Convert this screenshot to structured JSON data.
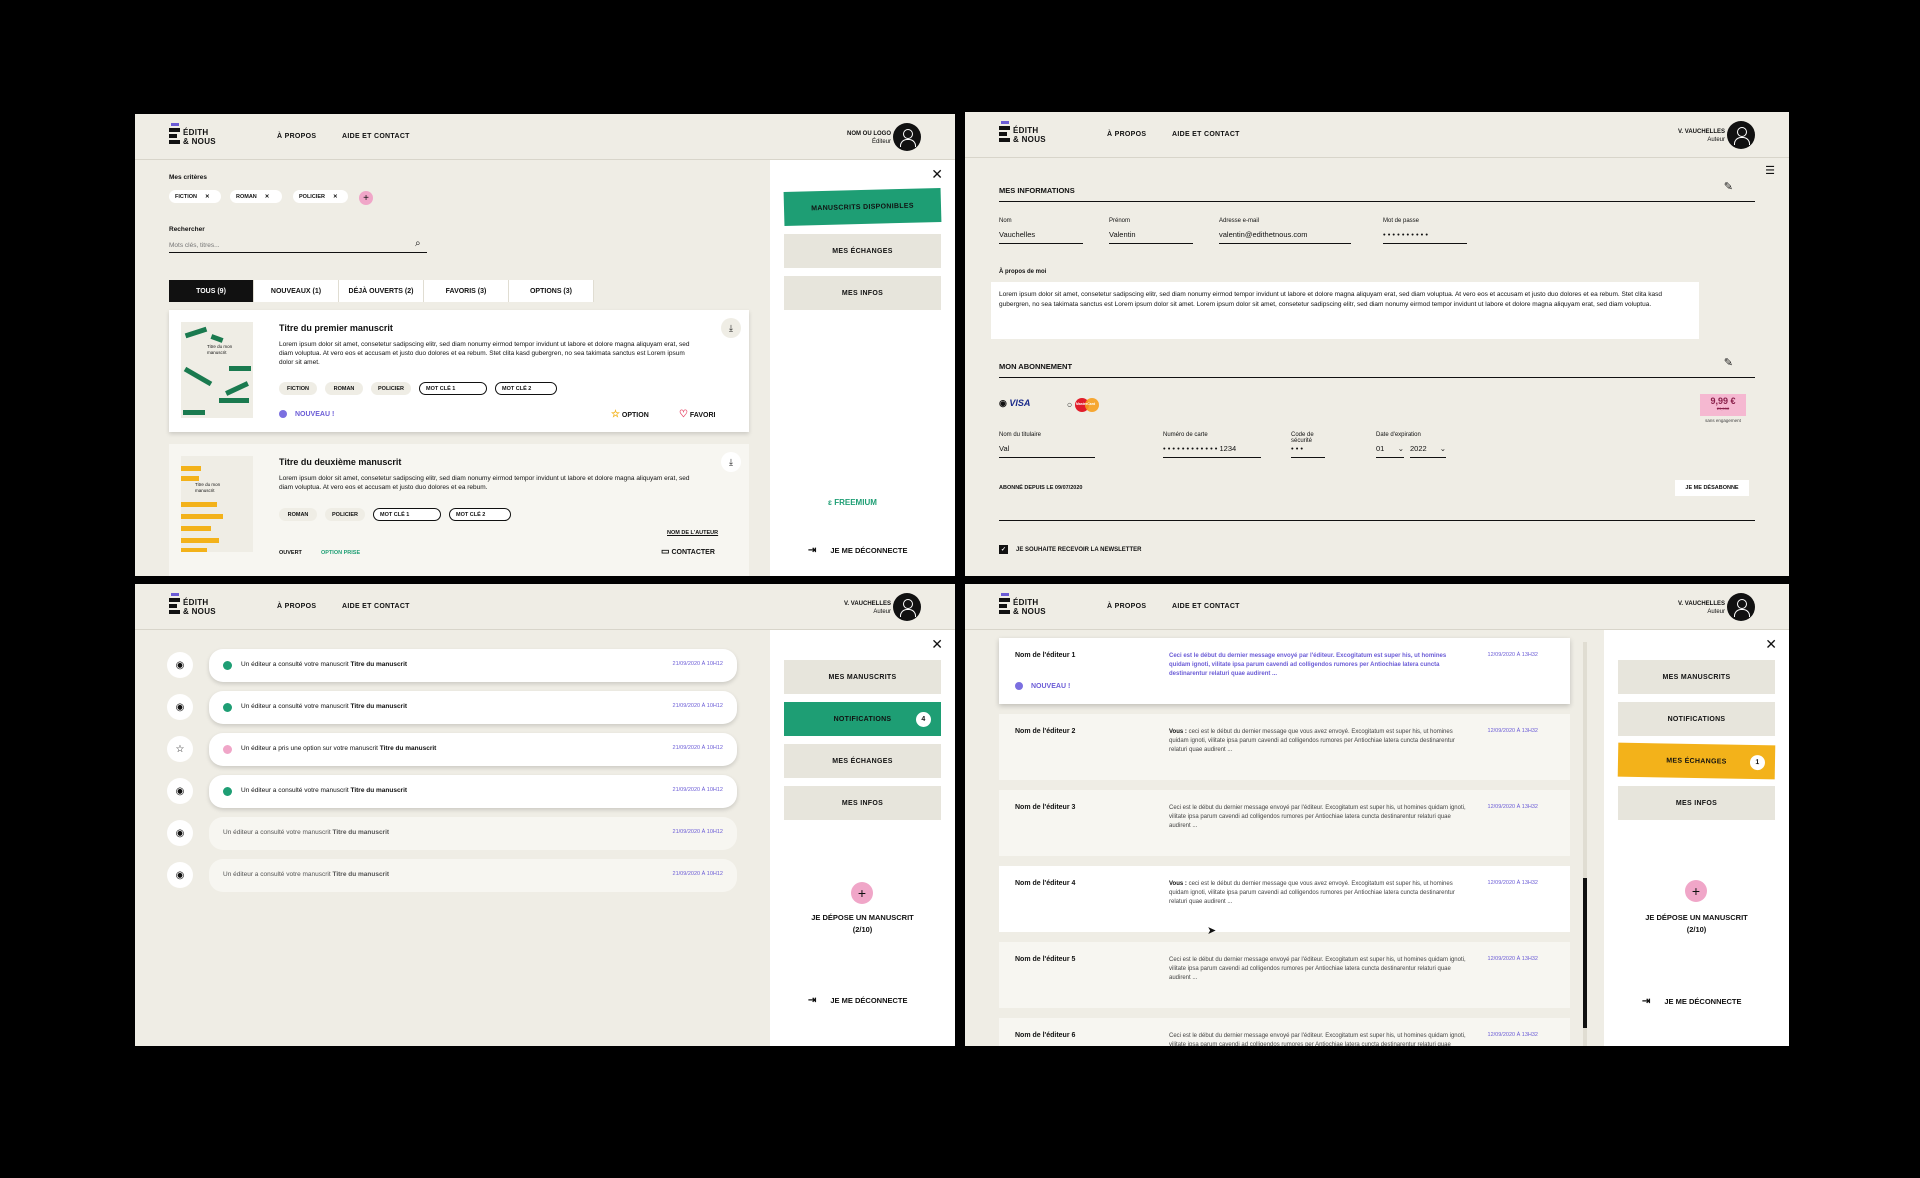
{
  "brand": {
    "line1": "ÉDITH",
    "line2": "& NOUS"
  },
  "nav": {
    "about": "À PROPOS",
    "help": "AIDE ET CONTACT"
  },
  "logout": "JE ME DÉCONNECTE",
  "screen1": {
    "user": {
      "name": "NOM OU LOGO",
      "role": "Éditeur"
    },
    "criteria_label": "Mes critères",
    "criteria": [
      "FICTION",
      "ROMAN",
      "POLICIER"
    ],
    "search": {
      "label": "Rechercher",
      "placeholder": "Mots clés, titres..."
    },
    "tabs": [
      "TOUS (9)",
      "NOUVEAUX (1)",
      "DÉJÀ OUVERTS (2)",
      "FAVORIS (3)",
      "OPTIONS (3)"
    ],
    "cards": [
      {
        "thumb": "Titre du mon manuscrit",
        "title": "Titre du premier manuscrit",
        "text": "Lorem ipsum dolor sit amet, consetetur sadipscing elitr, sed diam nonumy eirmod tempor invidunt ut labore et dolore magna aliquyam erat, sed diam voluptua. At vero eos et accusam et justo duo dolores et ea rebum. Stet clita kasd gubergren, no sea takimata sanctus est Lorem ipsum dolor sit amet.",
        "tags": [
          "FICTION",
          "ROMAN",
          "POLICIER"
        ],
        "keywords": [
          "MOT CLÉ 1",
          "MOT CLÉ 2"
        ],
        "status": "NOUVEAU !",
        "option": "OPTION",
        "favori": "FAVORI"
      },
      {
        "thumb": "Titre du mon manuscrit",
        "title": "Titre du deuxième manuscrit",
        "text": "Lorem ipsum dolor sit amet, consetetur sadipscing elitr, sed diam nonumy eirmod tempor invidunt ut labore et dolore magna aliquyam erat, sed diam voluptua. At vero eos et accusam et justo duo dolores et ea rebum.",
        "tags": [
          "ROMAN",
          "POLICIER"
        ],
        "keywords": [
          "MOT CLÉ 1",
          "MOT CLÉ 2"
        ],
        "author_link": "NOM DE L'AUTEUR",
        "status": "OUVERT",
        "option_taken": "OPTION PRISE",
        "contact": "CONTACTER"
      }
    ],
    "menu": [
      "MANUSCRITS DISPONIBLES",
      "MES ÉCHANGES",
      "MES INFOS"
    ],
    "plan": "FREEMIUM"
  },
  "screen2": {
    "user": {
      "name": "V. VAUCHELLES",
      "role": "Auteur"
    },
    "info_title": "MES INFORMATIONS",
    "fields": [
      {
        "label": "Nom",
        "value": "Vauchelles"
      },
      {
        "label": "Prénom",
        "value": "Valentin"
      },
      {
        "label": "Adresse e-mail",
        "value": "valentin@edithetnous.com"
      },
      {
        "label": "Mot de passe",
        "value": "• • • • • • • • • •"
      }
    ],
    "about_label": "À propos de moi",
    "about_text": "Lorem ipsum dolor sit amet, consetetur sadipscing elitr, sed diam nonumy eirmod tempor invidunt ut labore et dolore magna aliquyam erat, sed diam voluptua. At vero eos et accusam et justo duo dolores et ea rebum. Stet clita kasd gubergren, no sea takimata sanctus est Lorem ipsum dolor sit amet. Lorem ipsum dolor sit amet, consetetur sadipscing elitr, sed diam nonumy eirmod tempor invidunt ut labore et dolore magna aliquyam erat, sed diam voluptua.",
    "sub_title": "MON ABONNEMENT",
    "visa": "VISA",
    "mastercard": "MasterCard",
    "price": "9,99 €",
    "price_old": "29,99€",
    "price_note": "sans engagement",
    "card_fields": [
      {
        "label": "Nom du titulaire",
        "value": "Val"
      },
      {
        "label": "Numéro de carte",
        "value": "• • • •   • • • •   • • • •   1234"
      },
      {
        "label": "Code de sécurité",
        "value": "• • •"
      },
      {
        "label": "Date d'expiration",
        "month": "01",
        "year": "2022"
      }
    ],
    "since": "ABONNÉ DEPUIS LE 09/07/2020",
    "unsubscribe": "JE ME DÉSABONNE",
    "newsletter": "JE SOUHAITE RECEVOIR LA NEWSLETTER"
  },
  "screen3": {
    "user": {
      "name": "V. VAUCHELLES",
      "role": "Auteur"
    },
    "notifications": [
      {
        "icon": "eye",
        "text": "Un éditeur a consulté votre manuscrit ",
        "bold": "Titre du manuscrit",
        "date": "21/09/2020 À 10H12",
        "dot": "#1e9e74",
        "read": false
      },
      {
        "icon": "eye",
        "text": "Un éditeur a consulté votre manuscrit ",
        "bold": "Titre du manuscrit",
        "date": "21/09/2020 À 10H12",
        "dot": "#1e9e74",
        "read": false
      },
      {
        "icon": "star",
        "text": "Un éditeur a pris une option sur votre manuscrit ",
        "bold": "Titre du manuscrit",
        "date": "21/09/2020 À 10H12",
        "dot": "#f0a6c8",
        "read": false
      },
      {
        "icon": "eye",
        "text": "Un éditeur a consulté votre manuscrit ",
        "bold": "Titre du manuscrit",
        "date": "21/09/2020 À 10H12",
        "dot": "#1e9e74",
        "read": false
      },
      {
        "icon": "eye",
        "text": "Un éditeur a consulté votre manuscrit ",
        "bold": "Titre du manuscrit",
        "date": "21/09/2020 À 10H12",
        "dot": "",
        "read": true
      },
      {
        "icon": "eye",
        "text": "Un éditeur a consulté votre manuscrit ",
        "bold": "Titre du manuscrit",
        "date": "21/09/2020 À 10H12",
        "dot": "",
        "read": true
      }
    ],
    "menu": [
      "MES MANUSCRITS",
      "NOTIFICATIONS",
      "MES ÉCHANGES",
      "MES INFOS"
    ],
    "notif_count": "4",
    "depose": "JE DÉPOSE UN MANUSCRIT",
    "depose_count": "(2/10)"
  },
  "screen4": {
    "user": {
      "name": "V. VAUCHELLES",
      "role": "Auteur"
    },
    "messages": [
      {
        "name": "Nom de l'éditeur 1",
        "prefix": "",
        "text": "Ceci est le début du dernier message envoyé par l'éditeur. Excogitatum est super his, ut homines quidam ignoti, vilitate ipsa parum cavendi ad colligendos rumores per Antiochiae latera cuncta destinarentur relaturi quae audirent ...",
        "date": "12/09/2020 À 13H32",
        "status": "NOUVEAU !"
      },
      {
        "name": "Nom de l'éditeur 2",
        "prefix": "Vous : ",
        "text": "ceci est le début du dernier message que vous avez envoyé. Excogitatum est super his, ut homines quidam ignoti, vilitate ipsa parum cavendi ad colligendos rumores per Antiochiae latera cuncta destinarentur relaturi quae audirent ...",
        "date": "12/09/2020 À 13H32"
      },
      {
        "name": "Nom de l'éditeur 3",
        "prefix": "",
        "text": "Ceci est le début du dernier message envoyé par l'éditeur. Excogitatum est super his, ut homines quidam ignoti, vilitate ipsa parum cavendi ad colligendos rumores per Antiochiae latera cuncta destinarentur relaturi quae audirent ...",
        "date": "12/09/2020 À 13H32"
      },
      {
        "name": "Nom de l'éditeur 4",
        "prefix": "Vous : ",
        "text": "ceci est le début du dernier message que vous avez envoyé. Excogitatum est super his, ut homines quidam ignoti, vilitate ipsa parum cavendi ad colligendos rumores per Antiochiae latera cuncta destinarentur relaturi quae audirent ...",
        "date": "12/09/2020 À 13H32"
      },
      {
        "name": "Nom de l'éditeur 5",
        "prefix": "",
        "text": "Ceci est le début du dernier message envoyé par l'éditeur. Excogitatum est super his, ut homines quidam ignoti, vilitate ipsa parum cavendi ad colligendos rumores per Antiochiae latera cuncta destinarentur relaturi quae audirent ...",
        "date": "12/09/2020 À 13H32"
      },
      {
        "name": "Nom de l'éditeur 6",
        "prefix": "",
        "text": "Ceci est le début du dernier message envoyé par l'éditeur. Excogitatum est super his, ut homines quidam ignoti, vilitate ipsa parum cavendi ad colligendos rumores per Antiochiae latera cuncta destinarentur relaturi quae audirent ...",
        "date": "12/09/2020 À 13H32"
      }
    ],
    "menu": [
      "MES MANUSCRITS",
      "NOTIFICATIONS",
      "MES ÉCHANGES",
      "MES INFOS"
    ],
    "exchange_count": "1",
    "depose": "JE DÉPOSE UN MANUSCRIT",
    "depose_count": "(2/10)"
  },
  "colors": {
    "green": "#1e9e74",
    "yellow": "#f3b21a",
    "purple": "#6b5cd6",
    "pink": "#f0a6c8",
    "beige": "#efede5"
  }
}
